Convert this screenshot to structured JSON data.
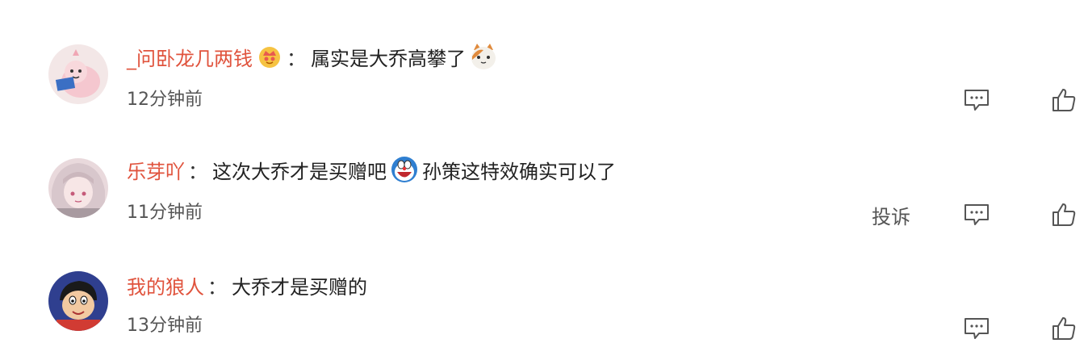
{
  "comments": [
    {
      "username": "_问卧龙几两钱",
      "badge_icon": "crown-badge-icon",
      "separator": "：",
      "text_parts": [
        "属实是大乔高攀了"
      ],
      "emoji_icons": [
        "cat-emoji-icon"
      ],
      "time": "12分钟前",
      "avatar": "pink-cartoon-avatar"
    },
    {
      "username": "乐芽吖",
      "separator": "：",
      "text_parts": [
        "这次大乔才是买赠吧",
        "孙策这特效确实可以了"
      ],
      "emoji_icons": [
        "doraemon-laugh-emoji-icon"
      ],
      "time": "11分钟前",
      "report_label": "投诉",
      "avatar": "anime-girl-avatar"
    },
    {
      "username": "我的狼人",
      "separator": "：",
      "text_parts": [
        "大乔才是买赠的"
      ],
      "time": "13分钟前",
      "avatar": "crayon-shin-chan-avatar"
    }
  ],
  "colors": {
    "username": "#e0533d",
    "text": "#222222",
    "meta": "#555555",
    "icon": "#555555"
  },
  "icons": {
    "reply": "comment-icon",
    "like": "thumbs-up-icon"
  }
}
